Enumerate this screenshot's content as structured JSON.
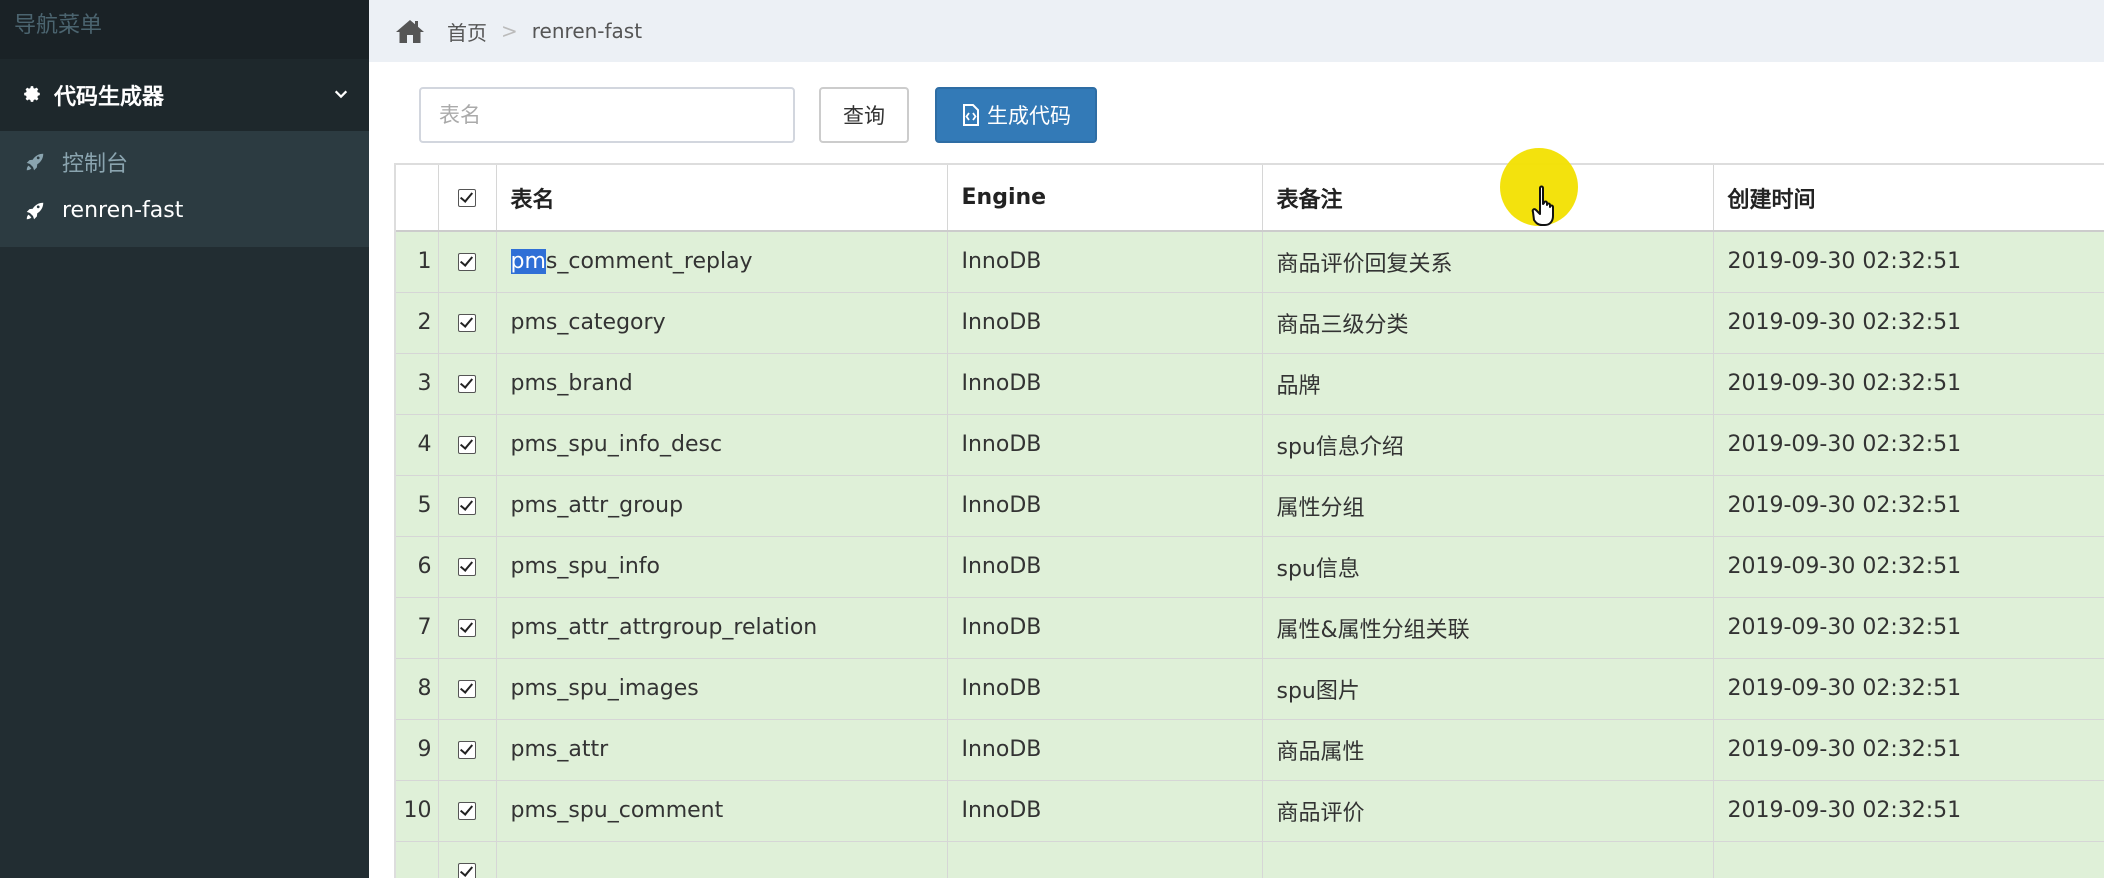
{
  "sidebar": {
    "header": "导航菜单",
    "root": {
      "label": "代码生成器",
      "icon": "gear-icon",
      "expanded_icon": "chevron-down-icon"
    },
    "items": [
      {
        "label": "控制台",
        "icon": "rocket-icon",
        "active": false
      },
      {
        "label": "renren-fast",
        "icon": "rocket-icon",
        "active": true
      }
    ]
  },
  "breadcrumb": {
    "home_label": "首页",
    "separator": ">",
    "current": "renren-fast"
  },
  "toolbar": {
    "search_placeholder": "表名",
    "query_label": "查询",
    "generate_label": "生成代码"
  },
  "table": {
    "headers": {
      "table_name": "表名",
      "engine": "Engine",
      "comment": "表备注",
      "created": "创建时间"
    },
    "rows": [
      {
        "no": "1",
        "table_name_highlight": "pm",
        "table_name_rest": "s_comment_replay",
        "engine": "InnoDB",
        "comment": "商品评价回复关系",
        "created": "2019-09-30 02:32:51"
      },
      {
        "no": "2",
        "table_name": "pms_category",
        "engine": "InnoDB",
        "comment": "商品三级分类",
        "created": "2019-09-30 02:32:51"
      },
      {
        "no": "3",
        "table_name": "pms_brand",
        "engine": "InnoDB",
        "comment": "品牌",
        "created": "2019-09-30 02:32:51"
      },
      {
        "no": "4",
        "table_name": "pms_spu_info_desc",
        "engine": "InnoDB",
        "comment": "spu信息介绍",
        "created": "2019-09-30 02:32:51"
      },
      {
        "no": "5",
        "table_name": "pms_attr_group",
        "engine": "InnoDB",
        "comment": "属性分组",
        "created": "2019-09-30 02:32:51"
      },
      {
        "no": "6",
        "table_name": "pms_spu_info",
        "engine": "InnoDB",
        "comment": "spu信息",
        "created": "2019-09-30 02:32:51"
      },
      {
        "no": "7",
        "table_name": "pms_attr_attrgroup_relation",
        "engine": "InnoDB",
        "comment": "属性&属性分组关联",
        "created": "2019-09-30 02:32:51"
      },
      {
        "no": "8",
        "table_name": "pms_spu_images",
        "engine": "InnoDB",
        "comment": "spu图片",
        "created": "2019-09-30 02:32:51"
      },
      {
        "no": "9",
        "table_name": "pms_attr",
        "engine": "InnoDB",
        "comment": "商品属性",
        "created": "2019-09-30 02:32:51"
      },
      {
        "no": "10",
        "table_name": "pms_spu_comment",
        "engine": "InnoDB",
        "comment": "商品评价",
        "created": "2019-09-30 02:32:51"
      }
    ]
  },
  "colors": {
    "sidebar_bg": "#222d32",
    "row_selected_bg": "#dff0d8",
    "primary_button": "#337ab7",
    "cursor_highlight": "#f2e000"
  }
}
